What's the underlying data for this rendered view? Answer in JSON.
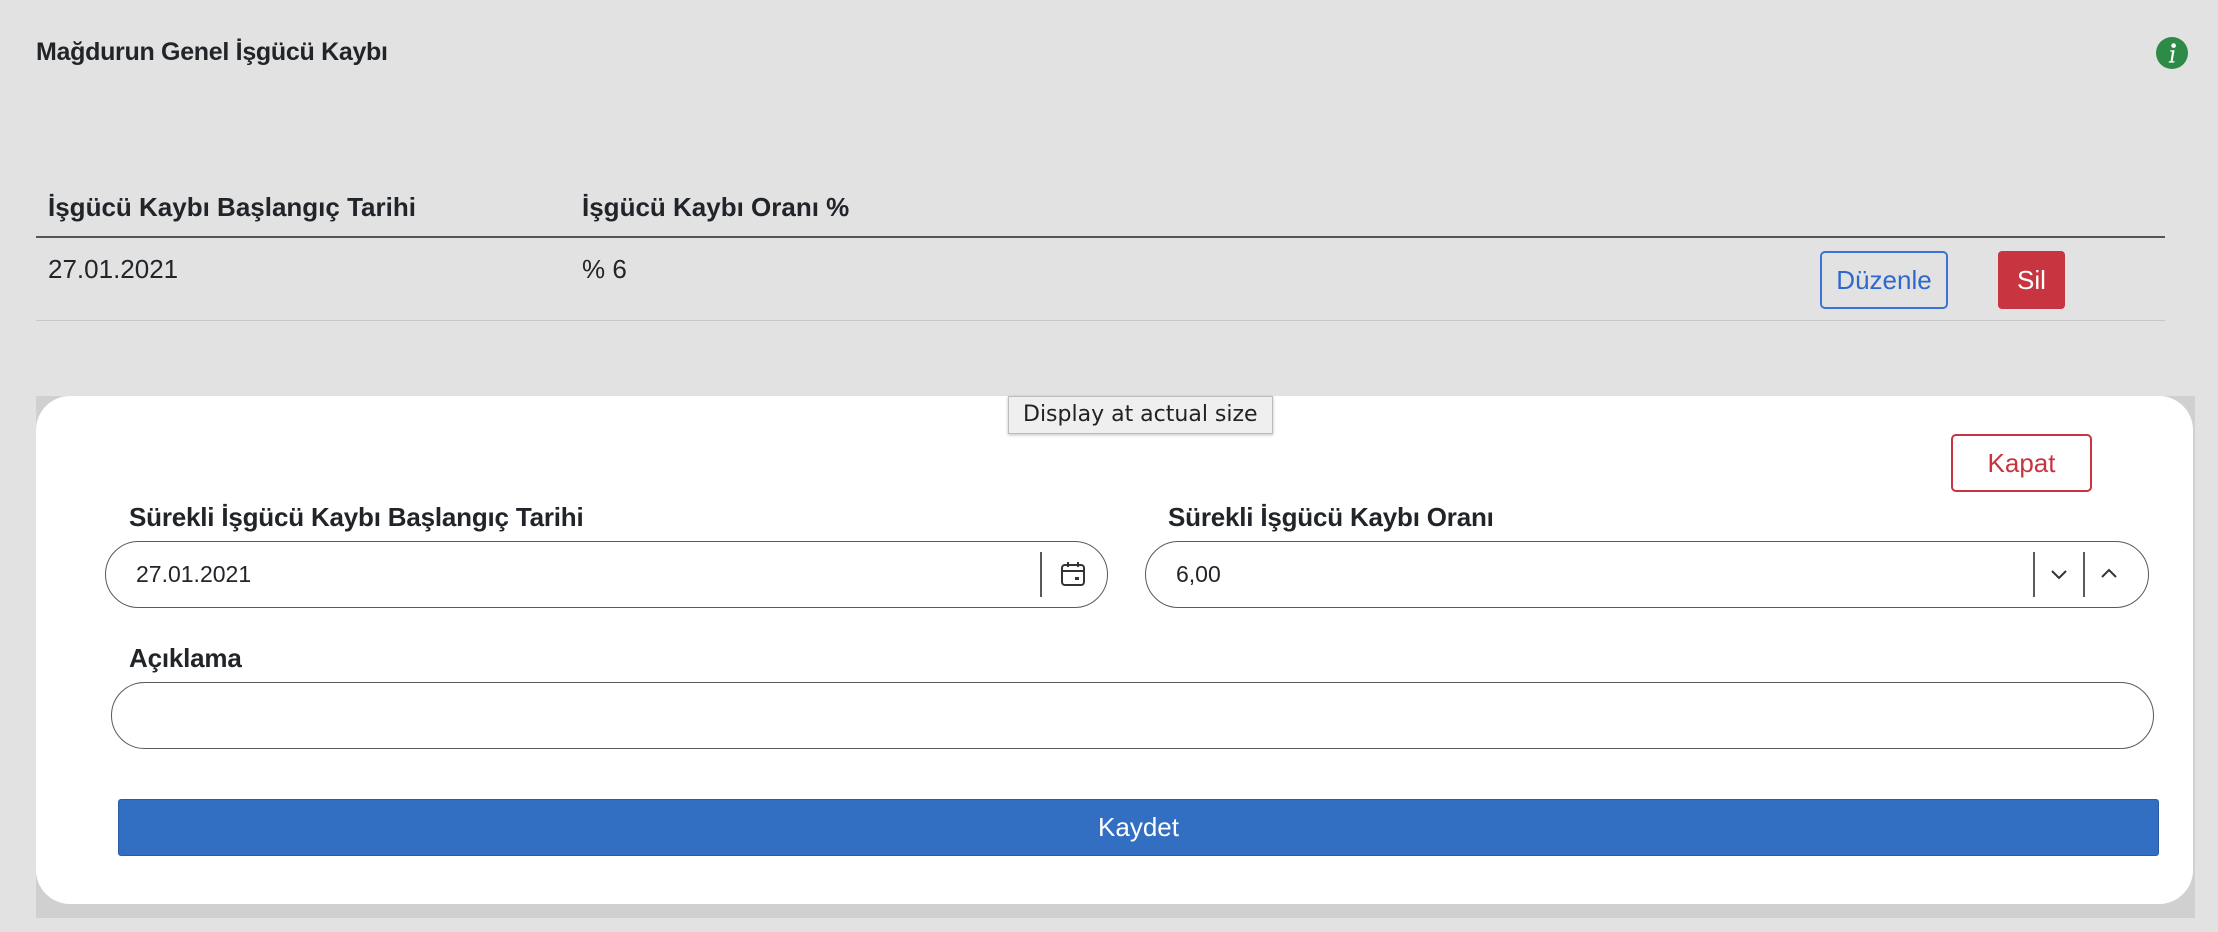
{
  "panel": {
    "title": "Mağdurun Genel İşgücü Kaybı",
    "info_icon": "info-icon",
    "info_color": "#2e8b47"
  },
  "table": {
    "headers": [
      "İşgücü Kaybı Başlangıç Tarihi",
      "İşgücü Kaybı Oranı %"
    ],
    "rows": [
      {
        "start_date": "27.01.2021",
        "rate": "% 6",
        "edit_label": "Düzenle",
        "delete_label": "Sil"
      }
    ]
  },
  "tooltip": "Display at actual size",
  "form": {
    "close_label": "Kapat",
    "start_date_label": "Sürekli İşgücü Kaybı Başlangıç Tarihi",
    "start_date_value": "27.01.2021",
    "calendar_icon": "calendar-icon",
    "rate_label": "Sürekli İşgücü Kaybı Oranı",
    "rate_value": "6,00",
    "decrement_icon": "chevron-down-icon",
    "increment_icon": "chevron-up-icon",
    "description_label": "Açıklama",
    "description_value": "",
    "save_label": "Kaydet"
  },
  "colors": {
    "primary": "#326ec1",
    "danger": "#c8343f",
    "background": "#e2e2e2",
    "card": "#ffffff"
  }
}
